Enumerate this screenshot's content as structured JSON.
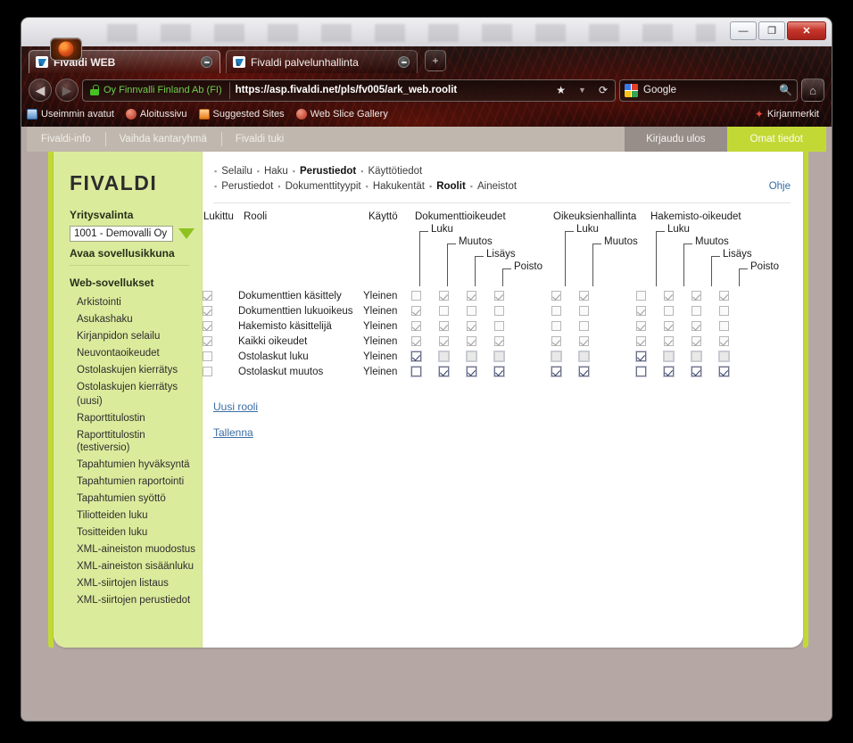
{
  "browser": {
    "window_buttons": {
      "minimize": "—",
      "maximize": "❐",
      "close": "✕"
    },
    "tabs": [
      {
        "title": "Fivaldi WEB",
        "active": true
      },
      {
        "title": "Fivaldi palvelunhallinta",
        "active": false
      }
    ],
    "new_tab_label": "+",
    "nav": {
      "back": "◀",
      "forward": "▶"
    },
    "ev_label": "Oy Finnvalli Finland Ab (FI)",
    "url": "https://asp.fivaldi.net/pls/fv005/ark_web.roolit",
    "url_icons": {
      "bookmark": "★",
      "dropdown": "▼",
      "reload": "⟳"
    },
    "search": {
      "engine": "Google",
      "icon": "🔍"
    },
    "home_icon": "⌂",
    "bookmarks": [
      {
        "label": "Useimmin avatut",
        "icon": "folder-icon"
      },
      {
        "label": "Aloitussivu",
        "icon": "page-icon"
      },
      {
        "label": "Suggested Sites",
        "icon": "suggested-icon"
      },
      {
        "label": "Web Slice Gallery",
        "icon": "webslice-icon"
      }
    ],
    "bookmarks_right": {
      "label": "Kirjanmerkit",
      "icon": "star-icon"
    }
  },
  "topnav": {
    "left_items": [
      "Fivaldi-info",
      "Vaihda kantaryhmä",
      "Fivaldi tuki"
    ],
    "logout": "Kirjaudu ulos",
    "profile": "Omat tiedot"
  },
  "sidebar": {
    "brand": "FIVALDI",
    "company_label": "Yritysvalinta",
    "company_value": "1001 - Demovalli Oy",
    "open_app": "Avaa sovellusikkuna",
    "apps_title": "Web-sovellukset",
    "apps": [
      "Arkistointi",
      "Asukashaku",
      "Kirjanpidon selailu",
      "Neuvontaoikeudet",
      "Ostolaskujen kierrätys",
      "Ostolaskujen kierrätys",
      "(uusi)",
      "Raporttitulostin",
      "Raporttitulostin (testiversio)",
      "Tapahtumien hyväksyntä",
      "Tapahtumien raportointi",
      "Tapahtumien syöttö",
      "Tiliotteiden luku",
      "Tositteiden luku",
      "XML-aineiston muodostus",
      "XML-aineiston sisäänluku",
      "XML-siirtojen listaus",
      "XML-siirtojen perustiedot"
    ]
  },
  "breadcrumbs": {
    "row1": [
      {
        "label": "Selailu",
        "active": false
      },
      {
        "label": "Haku",
        "active": false
      },
      {
        "label": "Perustiedot",
        "active": true
      },
      {
        "label": "Käyttötiedot",
        "active": false
      }
    ],
    "row2": [
      {
        "label": "Perustiedot",
        "active": false
      },
      {
        "label": "Dokumenttityypit",
        "active": false
      },
      {
        "label": "Hakukentät",
        "active": false
      },
      {
        "label": "Roolit",
        "active": true
      },
      {
        "label": "Aineistot",
        "active": false
      }
    ],
    "separator": "▪",
    "help": "Ohje"
  },
  "grid": {
    "col_locked": "Lukittu",
    "col_role": "Rooli",
    "col_use": "Käyttö",
    "groups": [
      {
        "title": "Dokumenttioikeudet",
        "subs": [
          "Luku",
          "Muutos",
          "Lisäys",
          "Poisto"
        ]
      },
      {
        "title": "Oikeuksienhallinta",
        "subs": [
          "Luku",
          "Muutos"
        ]
      },
      {
        "title": "Hakemisto-oikeudet",
        "subs": [
          "Luku",
          "Muutos",
          "Lisäys",
          "Poisto"
        ]
      }
    ],
    "rows": [
      {
        "locked": true,
        "role": "Dokumenttien käsittely",
        "use": "Yleinen",
        "doc": [
          false,
          true,
          true,
          true
        ],
        "rights": [
          true,
          true
        ],
        "dir": [
          false,
          true,
          true,
          true
        ],
        "focus": false
      },
      {
        "locked": true,
        "role": "Dokumenttien lukuoikeus",
        "use": "Yleinen",
        "doc": [
          true,
          false,
          false,
          false
        ],
        "rights": [
          false,
          false
        ],
        "dir": [
          true,
          false,
          false,
          false
        ],
        "focus": false
      },
      {
        "locked": true,
        "role": "Hakemisto käsittelijä",
        "use": "Yleinen",
        "doc": [
          true,
          true,
          true,
          false
        ],
        "rights": [
          false,
          false
        ],
        "dir": [
          true,
          true,
          true,
          false
        ],
        "focus": false
      },
      {
        "locked": true,
        "role": "Kaikki oikeudet",
        "use": "Yleinen",
        "doc": [
          true,
          true,
          true,
          true
        ],
        "rights": [
          true,
          true
        ],
        "dir": [
          true,
          true,
          true,
          true
        ],
        "focus": false
      },
      {
        "locked": false,
        "role": "Ostolaskut luku",
        "use": "Yleinen",
        "doc": [
          true,
          false,
          false,
          false
        ],
        "rights": [
          false,
          false
        ],
        "dir": [
          true,
          false,
          false,
          false
        ],
        "focus": true,
        "dim": true
      },
      {
        "locked": false,
        "role": "Ostolaskut muutos",
        "use": "Yleinen",
        "doc": [
          false,
          true,
          true,
          true
        ],
        "rights": [
          true,
          true
        ],
        "dir": [
          false,
          true,
          true,
          true
        ],
        "focus": true
      }
    ]
  },
  "actions": {
    "new_role": "Uusi rooli",
    "save": "Tallenna"
  },
  "colors": {
    "accent_green": "#c2d935",
    "sidebar_green": "#dbeb9c",
    "link_blue": "#3a6ea5",
    "chrome_dark": "#1a0d0c"
  }
}
